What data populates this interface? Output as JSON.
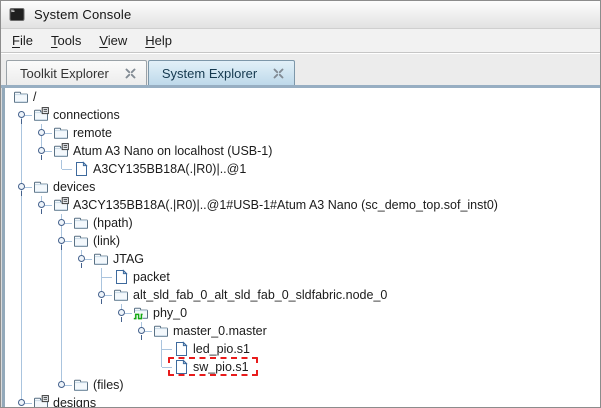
{
  "window": {
    "title": "System Console",
    "icon": "console-icon"
  },
  "menu": {
    "items": [
      "File",
      "Tools",
      "View",
      "Help"
    ]
  },
  "tab_bar": {
    "tabs": [
      {
        "label": "Toolkit Explorer",
        "active": false,
        "close_icon": "close-icon"
      },
      {
        "label": "System Explorer",
        "active": true,
        "close_icon": "close-icon"
      }
    ]
  },
  "colors": {
    "tab_active_top": "#e2f0f8",
    "tab_active_bottom": "#bed9ea",
    "panel_border": "#97aec2",
    "tree_guide": "#aac4de",
    "highlight": "#e81c1c",
    "wave_green": "#12a812"
  },
  "highlight": {
    "style": "dashed",
    "color": "#e81c1c",
    "target": "sw_pio.s1"
  },
  "tree": {
    "rows": [
      {
        "label": "/",
        "level": 0,
        "icon": "folder",
        "handle": null,
        "guides": []
      },
      {
        "label": "connections",
        "level": 1,
        "icon": "folder-badge",
        "handle": "expanded",
        "guides": [
          {
            "col": 1,
            "seg": "lower"
          }
        ]
      },
      {
        "label": "remote",
        "level": 2,
        "icon": "folder",
        "handle": "collapsed",
        "guides": [
          {
            "col": 1,
            "seg": "full"
          },
          {
            "col": 2,
            "seg": "full"
          }
        ]
      },
      {
        "label": "Atum A3 Nano on localhost (USB-1)",
        "level": 2,
        "icon": "folder-badge",
        "handle": "expanded",
        "guides": [
          {
            "col": 1,
            "seg": "full"
          },
          {
            "col": 2,
            "seg": "upper"
          }
        ]
      },
      {
        "label": "A3CY135BB18A(.|R0)|..@1",
        "level": 3,
        "icon": "file",
        "handle": null,
        "guides": [
          {
            "col": 1,
            "seg": "full"
          },
          {
            "col": 3,
            "seg": "upper"
          }
        ]
      },
      {
        "label": "devices",
        "level": 1,
        "icon": "folder",
        "handle": "expanded",
        "guides": [
          {
            "col": 1,
            "seg": "full"
          }
        ]
      },
      {
        "label": "A3CY135BB18A(.|R0)|..@1#USB-1#Atum A3 Nano (sc_demo_top.sof_inst0)",
        "level": 2,
        "icon": "folder-badge",
        "handle": "expanded",
        "guides": [
          {
            "col": 1,
            "seg": "full"
          },
          {
            "col": 2,
            "seg": "upper"
          }
        ]
      },
      {
        "label": "(hpath)",
        "level": 3,
        "icon": "folder",
        "handle": "collapsed",
        "guides": [
          {
            "col": 1,
            "seg": "full"
          },
          {
            "col": 3,
            "seg": "full"
          }
        ]
      },
      {
        "label": "(link)",
        "level": 3,
        "icon": "folder",
        "handle": "expanded",
        "guides": [
          {
            "col": 1,
            "seg": "full"
          },
          {
            "col": 3,
            "seg": "full"
          }
        ]
      },
      {
        "label": "JTAG",
        "level": 4,
        "icon": "folder",
        "handle": "expanded",
        "guides": [
          {
            "col": 1,
            "seg": "full"
          },
          {
            "col": 3,
            "seg": "full"
          },
          {
            "col": 4,
            "seg": "upper"
          }
        ]
      },
      {
        "label": "packet",
        "level": 5,
        "icon": "file",
        "handle": null,
        "guides": [
          {
            "col": 1,
            "seg": "full"
          },
          {
            "col": 3,
            "seg": "full"
          },
          {
            "col": 5,
            "seg": "full"
          }
        ]
      },
      {
        "label": "alt_sld_fab_0_alt_sld_fab_0_sldfabric.node_0",
        "level": 5,
        "icon": "folder",
        "handle": "expanded",
        "guides": [
          {
            "col": 1,
            "seg": "full"
          },
          {
            "col": 3,
            "seg": "full"
          },
          {
            "col": 5,
            "seg": "upper"
          }
        ]
      },
      {
        "label": "phy_0",
        "level": 6,
        "icon": "folder-wave",
        "handle": "expanded",
        "guides": [
          {
            "col": 1,
            "seg": "full"
          },
          {
            "col": 3,
            "seg": "full"
          },
          {
            "col": 6,
            "seg": "upper"
          }
        ]
      },
      {
        "label": "master_0.master",
        "level": 7,
        "icon": "folder",
        "handle": "expanded",
        "guides": [
          {
            "col": 1,
            "seg": "full"
          },
          {
            "col": 3,
            "seg": "full"
          },
          {
            "col": 7,
            "seg": "upper"
          }
        ]
      },
      {
        "label": "led_pio.s1",
        "level": 8,
        "icon": "file",
        "handle": null,
        "guides": [
          {
            "col": 1,
            "seg": "full"
          },
          {
            "col": 3,
            "seg": "full"
          },
          {
            "col": 8,
            "seg": "full"
          }
        ]
      },
      {
        "label": "sw_pio.s1",
        "level": 8,
        "icon": "file",
        "handle": null,
        "highlighted": true,
        "guides": [
          {
            "col": 1,
            "seg": "full"
          },
          {
            "col": 3,
            "seg": "full"
          },
          {
            "col": 8,
            "seg": "upper"
          }
        ]
      },
      {
        "label": "(files)",
        "level": 3,
        "icon": "folder",
        "handle": "collapsed",
        "guides": [
          {
            "col": 1,
            "seg": "full"
          },
          {
            "col": 3,
            "seg": "upper"
          }
        ]
      },
      {
        "label": "designs",
        "level": 1,
        "icon": "folder-badge",
        "handle": "collapsed",
        "guides": [
          {
            "col": 1,
            "seg": "upper"
          }
        ]
      }
    ]
  }
}
